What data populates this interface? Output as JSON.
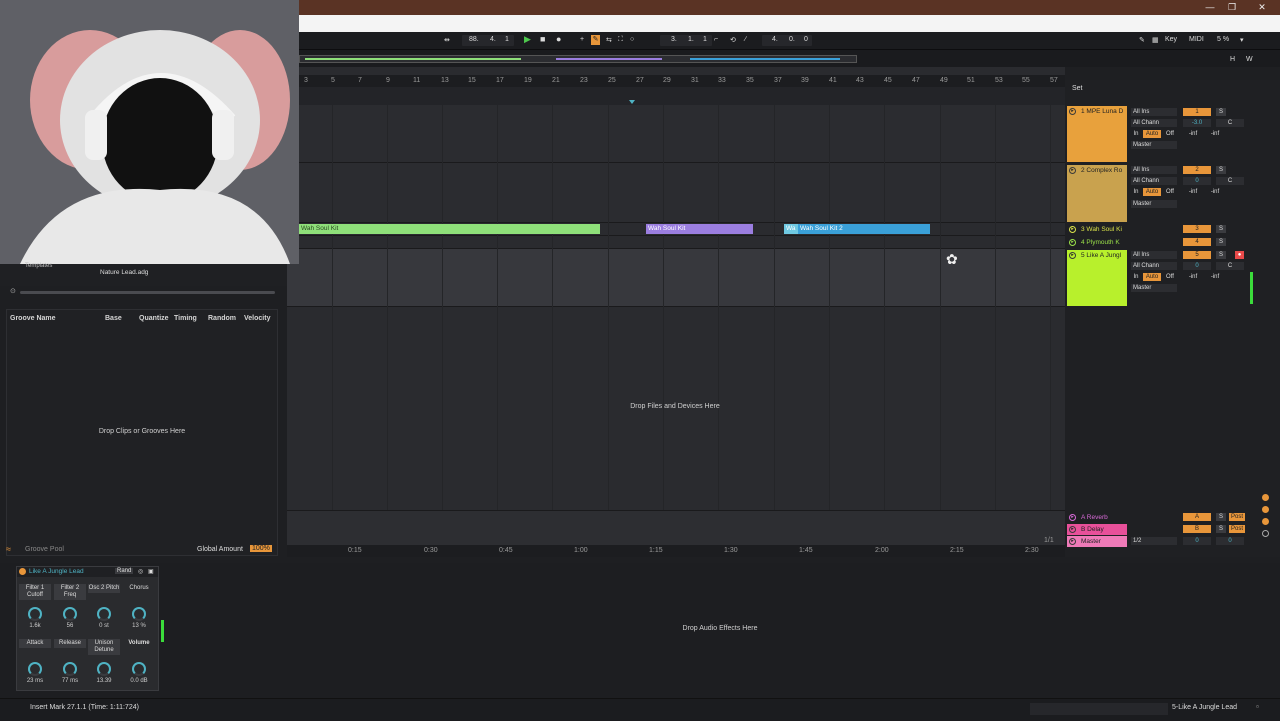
{
  "window": {
    "minimize": "—",
    "restore": "❐",
    "close": "✕"
  },
  "transport": {
    "tempo": "88.",
    "sig_num": "4.",
    "sig_den": "1",
    "position": "3.",
    "position_beat": "1.",
    "position_sixteenth": "1",
    "loop_length": "4.",
    "loop_beat": "0.",
    "loop_sixteenth": "0",
    "key_label": "Key",
    "midi_label": "MIDI",
    "cpu": "5 %",
    "h_label": "H",
    "w_label": "W"
  },
  "ruler": {
    "bars": [
      "3",
      "5",
      "7",
      "9",
      "11",
      "13",
      "15",
      "17",
      "19",
      "21",
      "23",
      "25",
      "27",
      "29",
      "31",
      "33",
      "35",
      "37",
      "39",
      "41",
      "43",
      "45",
      "47",
      "49",
      "51",
      "53",
      "55",
      "57"
    ]
  },
  "clips": [
    {
      "name": "Wah Soul Kit",
      "color": "#8fe07a"
    },
    {
      "name": "Wah Soul Kit",
      "color": "#9b7ee0"
    },
    {
      "name": "Wa",
      "color": "#6fc9e2"
    },
    {
      "name": "Wah Soul Kit 2",
      "color": "#3aa0d8"
    }
  ],
  "arrangement": {
    "drop_text": "Drop Files and Devices Here"
  },
  "timeline": [
    "0:15",
    "0:30",
    "0:45",
    "1:00",
    "1:15",
    "1:30",
    "1:45",
    "2:00",
    "2:15",
    "2:30"
  ],
  "timeline_page": "1/1",
  "mixer": {
    "set_label": "Set",
    "tracks": [
      {
        "name": "1 MPE Luna D",
        "num": "1",
        "color": "#e8a13c",
        "input": "All Ins",
        "channel": "All Chann",
        "vol": "-3.0",
        "pan": "C"
      },
      {
        "name": "2 Complex Ro",
        "num": "2",
        "color": "#c9a24e",
        "input": "All Ins",
        "channel": "All Chann",
        "vol": "0",
        "pan": "C"
      },
      {
        "name": "3 Wah Soul Ki",
        "num": "3",
        "color": "#dbe34a"
      },
      {
        "name": "4 Plymouth K",
        "num": "4",
        "color": "#9be24a"
      },
      {
        "name": "5 Like A Jungl",
        "num": "5",
        "color": "#b8f02c",
        "input": "All Ins",
        "channel": "All Chann",
        "vol": "0",
        "pan": "C"
      }
    ],
    "monitor": {
      "in": "In",
      "auto": "Auto",
      "off": "Off"
    },
    "output": "Master",
    "inf": "-inf",
    "solo": "S",
    "returns": [
      {
        "name": "A Reverb",
        "letter": "A",
        "color": "#d86ad8",
        "post": "Post"
      },
      {
        "name": "B Delay",
        "letter": "B",
        "color": "#e8509a",
        "post": "Post"
      }
    ],
    "master": {
      "name": "Master",
      "cue": "1/2",
      "vol": "0",
      "pan": "0",
      "color": "#ef7ab8"
    }
  },
  "browser": {
    "templates_label": "Templates",
    "item": "Nature Lead.adg"
  },
  "groove": {
    "headers": [
      "Groove Name",
      "Base",
      "Quantize",
      "Timing",
      "Random",
      "Velocity"
    ],
    "drop_text": "Drop Clips or Grooves Here",
    "pool_label": "Groove Pool",
    "global_amount_label": "Global Amount",
    "global_amount": "100%"
  },
  "rack": {
    "title": "Like A Jungle Lead",
    "rand": "Rand",
    "macros": [
      {
        "label": "Filter 1 Cutoff",
        "value": "1.6k"
      },
      {
        "label": "Filter 2 Freq",
        "value": "56"
      },
      {
        "label": "Osc 2 Pitch",
        "value": "0 st"
      },
      {
        "label": "Chorus",
        "value": "13 %"
      },
      {
        "label": "Attack",
        "value": "23 ms"
      },
      {
        "label": "Release",
        "value": "77 ms"
      },
      {
        "label": "Unison Detune",
        "value": "13.39"
      },
      {
        "label": "Volume",
        "value": "0.0 dB"
      }
    ]
  },
  "device_drop_text": "Drop Audio Effects Here",
  "status": {
    "message": "Insert Mark 27.1.1 (Time: 1:11:724)",
    "track": "5-Like A Jungle Lead"
  }
}
